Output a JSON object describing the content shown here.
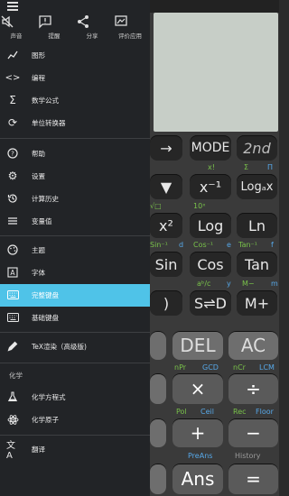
{
  "drawer": {
    "quick_actions": [
      {
        "label": "声音",
        "icon": "sound-off-icon"
      },
      {
        "label": "提醒",
        "icon": "message-icon"
      },
      {
        "label": "分享",
        "icon": "share-icon"
      },
      {
        "label": "评价应用",
        "icon": "rate-icon"
      }
    ],
    "group1": [
      "图形",
      "编程",
      "数学公式",
      "单位转换器"
    ],
    "group2": [
      "帮助",
      "设置",
      "计算历史",
      "变量值"
    ],
    "group3": [
      "主题",
      "字体",
      "完整键盘",
      "基础键盘"
    ],
    "group4": [
      "TeX渲染（高级版)"
    ],
    "section_title": "化学",
    "group5": [
      "化学方程式",
      "化学原子"
    ],
    "group6": [
      "翻译"
    ],
    "accent": "#4fc3e8"
  },
  "calc": {
    "keys": {
      "mode": "MODE",
      "second": "2nd",
      "x_inv": "x⁻¹",
      "log_a": "Logₐx",
      "log": "Log",
      "ln": "Ln",
      "sin": "Sin",
      "cos": "Cos",
      "tan": "Tan",
      "s_to_d": "S⇌D",
      "m_plus": "M+",
      "del": "DEL",
      "ac": "AC",
      "times": "×",
      "divide": "÷",
      "plus": "+",
      "minus": "−",
      "ans": "Ans",
      "equals": "=",
      "arrow": "→",
      "down": "▼",
      "x_sq": "x²",
      "paren": ")"
    },
    "sublabels": {
      "x_inv_top": "x!",
      "sigma": "Σ",
      "pi": "Π",
      "sin_inv": "Sin⁻¹",
      "d": "d",
      "cos_inv": "Cos⁻¹",
      "e": "e",
      "tan_inv": "Tan⁻¹",
      "f": "f",
      "a_b_c": "aᵇ/c",
      "y": "y",
      "m_minus": "M−",
      "m": "m",
      "npr": "nPr",
      "gcd": "GCD",
      "ncr": "nCr",
      "lcm": "LCM",
      "pol": "Pol",
      "ceil": "Ceil",
      "rec": "Rec",
      "floor": "Floor",
      "preans": "PreAns",
      "history": "History",
      "ten_x": "10ˣ",
      "vo": "√□"
    }
  }
}
